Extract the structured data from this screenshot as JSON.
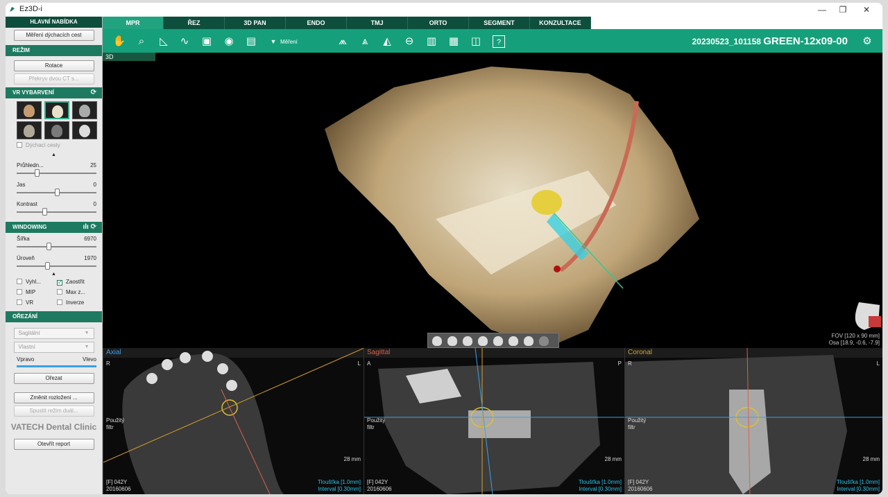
{
  "window": {
    "title": "Ez3D-i"
  },
  "sidebar": {
    "main_menu": "HLAVNÍ NABÍDKA",
    "breath_button": "Měření dýchacích cest",
    "mode_header": "REŽIM",
    "rotate_button": "Rotace",
    "overlay_button": "Překryv dvou CT s...",
    "vr_header": "VR VYBARVENÍ",
    "airway_check": "Dýchací cesty",
    "transparency": {
      "label": "Průhledn...",
      "value": "25",
      "level": 0.25
    },
    "brightness": {
      "label": "Jas",
      "value": "0",
      "level": 0.5
    },
    "contrast": {
      "label": "Kontrast",
      "value": "0",
      "level": 0.35
    },
    "windowing_header": "WINDOWING",
    "width": {
      "label": "Šířka",
      "value": "6970",
      "level": 0.4
    },
    "level": {
      "label": "Úroveň",
      "value": "1970",
      "level": 0.38
    },
    "checks": [
      {
        "label": "Vyhl...",
        "on": false
      },
      {
        "label": "Zaostřit",
        "on": true
      },
      {
        "label": "MIP",
        "on": false
      },
      {
        "label": "Max z...",
        "on": false
      },
      {
        "label": "VR",
        "on": false
      },
      {
        "label": "Inverze",
        "on": false
      }
    ],
    "crop_header": "OŘEZÁNÍ",
    "crop_dd1": "Sagitální",
    "crop_dd2": "Vlastní",
    "right_label": "Vpravo",
    "left_label": "Vlevo",
    "crop_button": "Ořezat",
    "layout_button": "Změnit rozložení ...",
    "dual_button": "Spustit režim duál...",
    "brand": "VATECH Dental Clinic",
    "open_report": "Otevřít report"
  },
  "tabs": [
    "MPR",
    "ŘEZ",
    "3D PAN",
    "ENDO",
    "TMJ",
    "ORTO",
    "SEGMENT",
    "KONZULTACE"
  ],
  "toolbar": {
    "measure_label": "Měření",
    "case_prefix": "20230523_101158",
    "case_name": "GREEN-12x09-00",
    "icons": [
      "hand-icon",
      "zoom-icon",
      "angle-icon",
      "curve-icon",
      "camera-icon",
      "capture-icon",
      "print-icon",
      "caret-icon",
      "ortho1-icon",
      "ortho2-icon",
      "bite-icon",
      "circle-icon",
      "image-icon",
      "layout-icon",
      "cube-icon",
      "help-icon",
      "settings-icon"
    ]
  },
  "view3d": {
    "tag": "3D",
    "fov": "FOV [120 x 90 mm]",
    "axis": "Osa [18.9, -0.6, -7.9]"
  },
  "panels": [
    {
      "name": "Axial",
      "color": "#3ca0e8",
      "tl": "R",
      "tr": "L",
      "filter": "Použitý\nfiltr",
      "scale": "28 mm",
      "bl1": "[F] 042Y",
      "bl2": "20160606",
      "br1": "Tloušťka [1.0mm]",
      "br2": "Interval [0.30mm]"
    },
    {
      "name": "Sagittal",
      "color": "#d9624a",
      "tl": "A",
      "tr": "P",
      "filter": "Použitý\nfiltr",
      "scale": "28 mm",
      "bl1": "[F] 042Y",
      "bl2": "20160606",
      "br1": "Tloušťka [1.0mm]",
      "br2": "Interval [0.30mm]"
    },
    {
      "name": "Coronal",
      "color": "#d9a02b",
      "tl": "R",
      "tr": "L",
      "filter": "Použitý\nfiltr",
      "scale": "28 mm",
      "bl1": "[F] 042Y",
      "bl2": "20160606",
      "br1": "Tloušťka [1.0mm]",
      "br2": "Interval [0.30mm]"
    }
  ],
  "colors": {
    "accent": "#15a07b",
    "dark": "#0d4e3c",
    "header": "#1d7a61"
  }
}
